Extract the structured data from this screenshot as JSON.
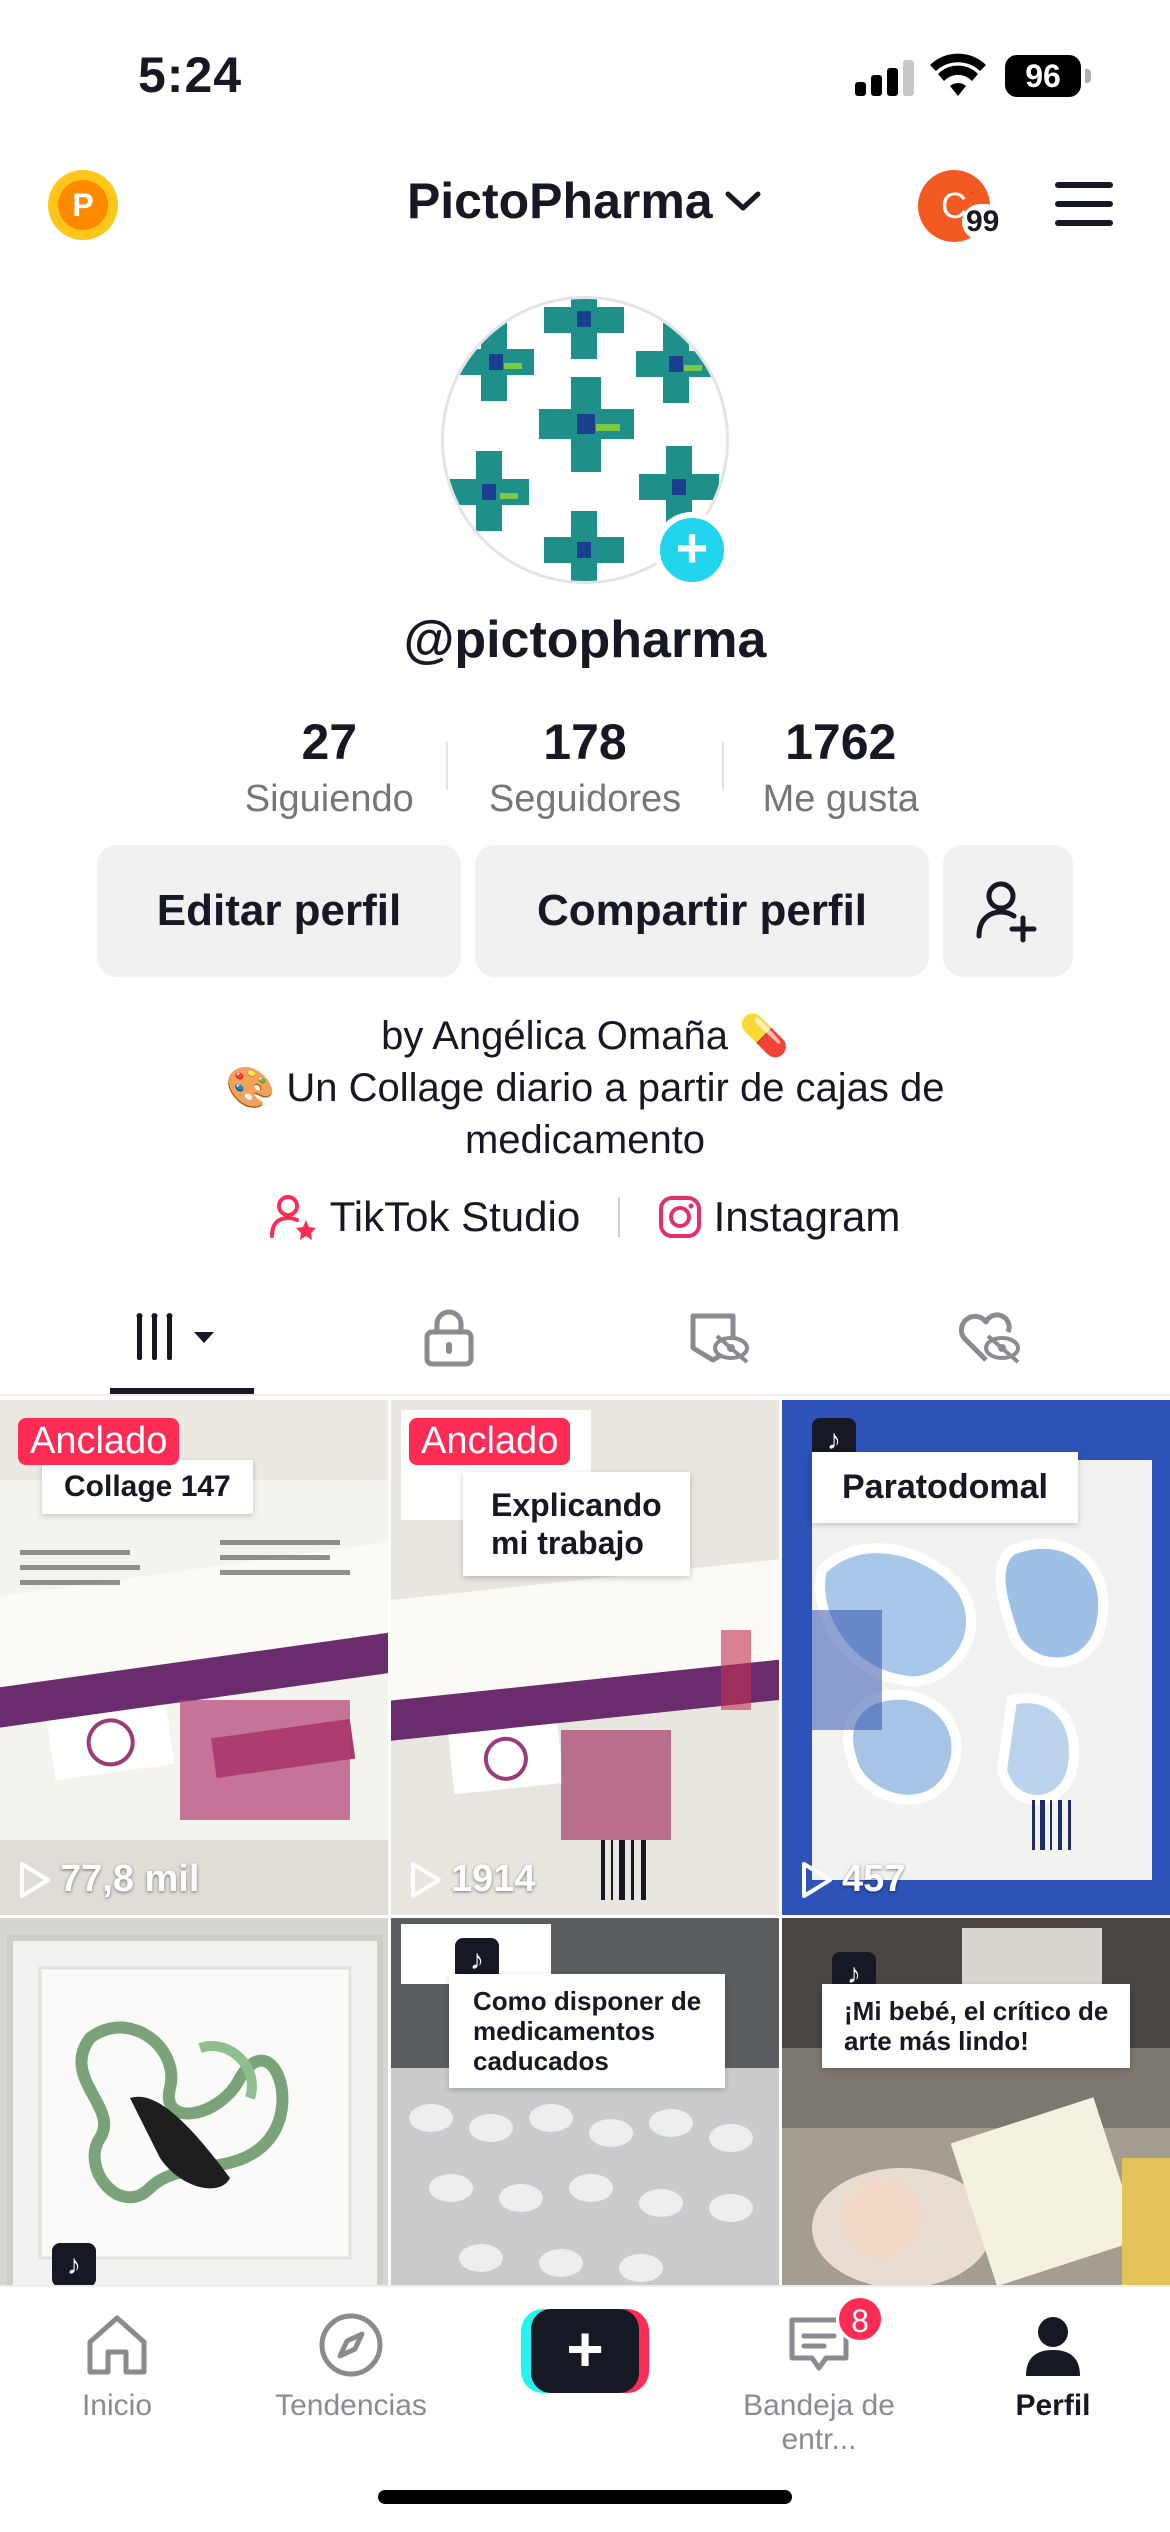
{
  "status_bar": {
    "time": "5:24",
    "battery": "96"
  },
  "header": {
    "account_name": "PictoPharma",
    "notification_count": "99",
    "avatar_letter": "C"
  },
  "profile": {
    "username": "@pictopharma",
    "stats": [
      {
        "value": "27",
        "label": "Siguiendo"
      },
      {
        "value": "178",
        "label": "Seguidores"
      },
      {
        "value": "1762",
        "label": "Me gusta"
      }
    ],
    "buttons": {
      "edit": "Editar perfil",
      "share": "Compartir perfil"
    },
    "bio_line1": "by Angélica Omaña 💊",
    "bio_line2": "🎨 Un Collage diario a partir de cajas de",
    "bio_line3": "medicamento",
    "links": {
      "studio": "TikTok Studio",
      "instagram": "Instagram"
    }
  },
  "tabs": [
    "videos-grid",
    "private",
    "reposts-hidden",
    "liked-hidden"
  ],
  "videos": [
    {
      "pinned": "Anclado",
      "caption": "Collage 147",
      "views": "77,8 mil"
    },
    {
      "pinned": "Anclado",
      "caption_line1": "Explicando",
      "caption_line2": "mi trabajo",
      "views": "1914"
    },
    {
      "caption": "Paratodomal",
      "views": "457"
    },
    {
      "caption": ""
    },
    {
      "caption_line1": "Como disponer de",
      "caption_line2": "medicamentos",
      "caption_line3": "caducados"
    },
    {
      "caption_line1": "¡Mi bebé, el crítico de",
      "caption_line2": "arte más lindo!"
    }
  ],
  "bottom_nav": {
    "home": "Inicio",
    "discover": "Tendencias",
    "inbox": "Bandeja de entr...",
    "inbox_badge": "8",
    "profile": "Perfil"
  },
  "colors": {
    "accent": "#fe2c55",
    "cyan": "#20d5ec",
    "text": "#161823"
  }
}
